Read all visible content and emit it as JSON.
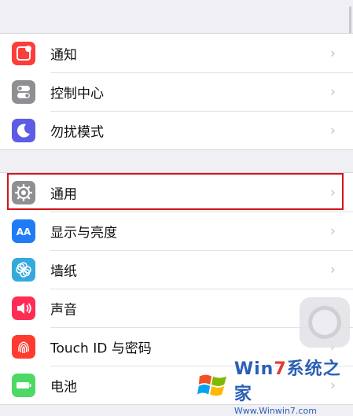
{
  "settings": {
    "group1": [
      {
        "label": "通知",
        "icon": "notifications-icon",
        "color": "#fc3d39"
      },
      {
        "label": "控制中心",
        "icon": "control-center-icon",
        "color": "#8e8e93"
      },
      {
        "label": "勿扰模式",
        "icon": "moon-icon",
        "color": "#5e5ce6"
      }
    ],
    "group2": [
      {
        "label": "通用",
        "icon": "gear-icon",
        "color": "#8e8e93"
      },
      {
        "label": "显示与亮度",
        "icon": "display-brightness-icon",
        "color": "#1f7cf6"
      },
      {
        "label": "墙纸",
        "icon": "wallpaper-icon",
        "color": "#34aadc"
      },
      {
        "label": "声音",
        "icon": "speaker-icon",
        "color": "#ff2d55"
      },
      {
        "label": "Touch ID 与密码",
        "icon": "fingerprint-icon",
        "color": "#ff3b30"
      },
      {
        "label": "电池",
        "icon": "battery-icon",
        "color": "#4cd964"
      }
    ],
    "chevron": "›"
  },
  "highlight_color": "#d3141a",
  "watermark": {
    "brand_prefix": "Win",
    "brand_seven": "7",
    "brand_suffix": "系统之家",
    "url": "Www.Winwin7.com"
  }
}
